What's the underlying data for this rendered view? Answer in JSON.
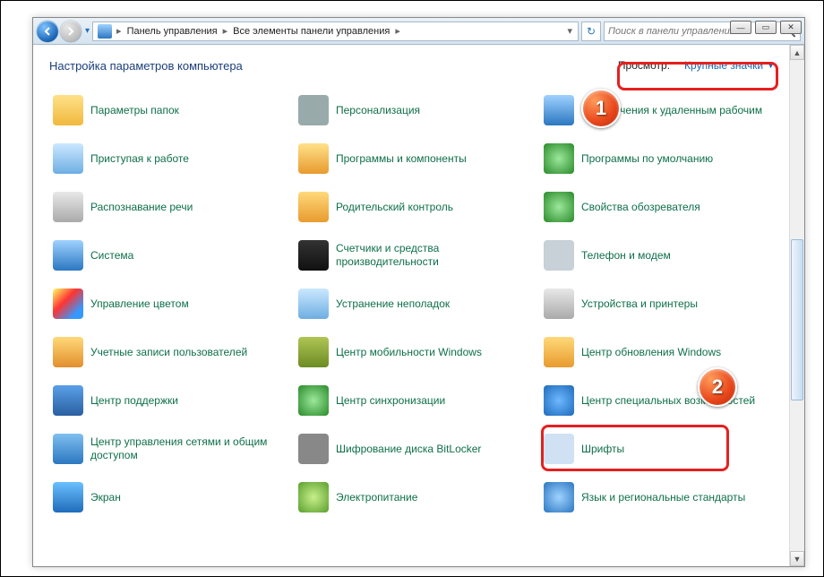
{
  "breadcrumb": {
    "seg1": "Панель управления",
    "seg2": "Все элементы панели управления"
  },
  "search": {
    "placeholder": "Поиск в панели управления"
  },
  "page_heading": "Настройка параметров компьютера",
  "view": {
    "label_prefix": "Просмотр:",
    "current": "Крупные значки"
  },
  "annotations": {
    "badge1": "1",
    "badge2": "2"
  },
  "items": [
    {
      "id": "folder-options",
      "label": "Параметры папок",
      "ico": "i-folder"
    },
    {
      "id": "personalization",
      "label": "Персонализация",
      "ico": "i-pers"
    },
    {
      "id": "remote-connect",
      "label": "Подключения к удаленным рабочим",
      "ico": "i-remote"
    },
    {
      "id": "getting-started",
      "label": "Приступая к работе",
      "ico": "i-run"
    },
    {
      "id": "programs-features",
      "label": "Программы и компоненты",
      "ico": "i-prog"
    },
    {
      "id": "default-programs",
      "label": "Программы по умолчанию",
      "ico": "i-def"
    },
    {
      "id": "speech",
      "label": "Распознавание речи",
      "ico": "i-mic"
    },
    {
      "id": "parental",
      "label": "Родительский контроль",
      "ico": "i-parent"
    },
    {
      "id": "internet-options",
      "label": "Свойства обозревателя",
      "ico": "i-inet"
    },
    {
      "id": "system",
      "label": "Система",
      "ico": "i-sys"
    },
    {
      "id": "perf-counters",
      "label": "Счетчики и средства производительности",
      "ico": "i-perf"
    },
    {
      "id": "phone-modem",
      "label": "Телефон и модем",
      "ico": "i-modem"
    },
    {
      "id": "color-mgmt",
      "label": "Управление цветом",
      "ico": "i-color"
    },
    {
      "id": "troubleshoot",
      "label": "Устранение неполадок",
      "ico": "i-trbl"
    },
    {
      "id": "devices-printers",
      "label": "Устройства и принтеры",
      "ico": "i-dev"
    },
    {
      "id": "user-accounts",
      "label": "Учетные записи пользователей",
      "ico": "i-users"
    },
    {
      "id": "mobility-center",
      "label": "Центр мобильности Windows",
      "ico": "i-mob"
    },
    {
      "id": "windows-update",
      "label": "Центр обновления Windows",
      "ico": "i-upd"
    },
    {
      "id": "action-center",
      "label": "Центр поддержки",
      "ico": "i-flag"
    },
    {
      "id": "sync-center",
      "label": "Центр синхронизации",
      "ico": "i-sync"
    },
    {
      "id": "ease-of-access",
      "label": "Центр специальных возможностей",
      "ico": "i-ease"
    },
    {
      "id": "network-sharing",
      "label": "Центр управления сетями и общим доступом",
      "ico": "i-net"
    },
    {
      "id": "bitlocker",
      "label": "Шифрование диска BitLocker",
      "ico": "i-bitl"
    },
    {
      "id": "fonts",
      "label": "Шрифты",
      "ico": "i-font"
    },
    {
      "id": "display",
      "label": "Экран",
      "ico": "i-screen"
    },
    {
      "id": "power",
      "label": "Электропитание",
      "ico": "i-power"
    },
    {
      "id": "region-lang",
      "label": "Язык и региональные стандарты",
      "ico": "i-region"
    }
  ]
}
